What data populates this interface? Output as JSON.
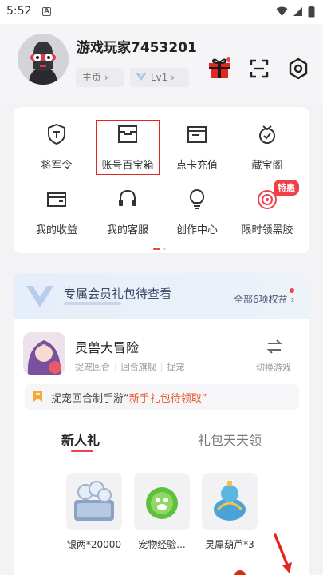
{
  "status_bar": {
    "time": "5:52",
    "notification_icon": "a-icon",
    "system_icons": [
      "wifi-icon",
      "signal-icon",
      "battery-icon"
    ]
  },
  "profile": {
    "username": "游戏玩家7453201",
    "home_label": "主页",
    "level_label": "Lv1",
    "header_icons": [
      "gift-icon",
      "scan-icon",
      "settings-icon"
    ]
  },
  "grid": {
    "items": [
      {
        "label": "将军令",
        "icon": "shield-t-icon"
      },
      {
        "label": "账号百宝箱",
        "icon": "treasure-box-icon"
      },
      {
        "label": "点卡充值",
        "icon": "card-icon"
      },
      {
        "label": "藏宝阁",
        "icon": "treasure-pavilion-icon"
      },
      {
        "label": "我的收益",
        "icon": "wallet-icon"
      },
      {
        "label": "我的客服",
        "icon": "headset-icon"
      },
      {
        "label": "创作中心",
        "icon": "bulb-icon"
      },
      {
        "label": "限时领黑胶",
        "icon": "vinyl-icon"
      }
    ],
    "badge": "特惠",
    "page_count": 2,
    "active_page": 0
  },
  "vip": {
    "title": "专属会员礼包待查看",
    "benefits_link": "全部6项权益"
  },
  "game": {
    "name": "灵兽大冒险",
    "tags": [
      "捉宠回合",
      "回合旗舰",
      "捉宠"
    ],
    "switch_label": "切换游戏"
  },
  "promo": {
    "prefix": "捉宠回合制手游“",
    "highlight": "新手礼包待领取",
    "suffix": "”"
  },
  "tabs": [
    {
      "label": "新人礼",
      "active": true
    },
    {
      "label": "礼包天天领",
      "active": false
    }
  ],
  "gifts": [
    {
      "name": "银两*20000"
    },
    {
      "name": "宠物经验..."
    },
    {
      "name": "灵犀葫芦*3"
    }
  ],
  "colors": {
    "accent_red": "#f0414a",
    "highlight_box": "#e2271e",
    "promo_highlight": "#e9542a"
  }
}
